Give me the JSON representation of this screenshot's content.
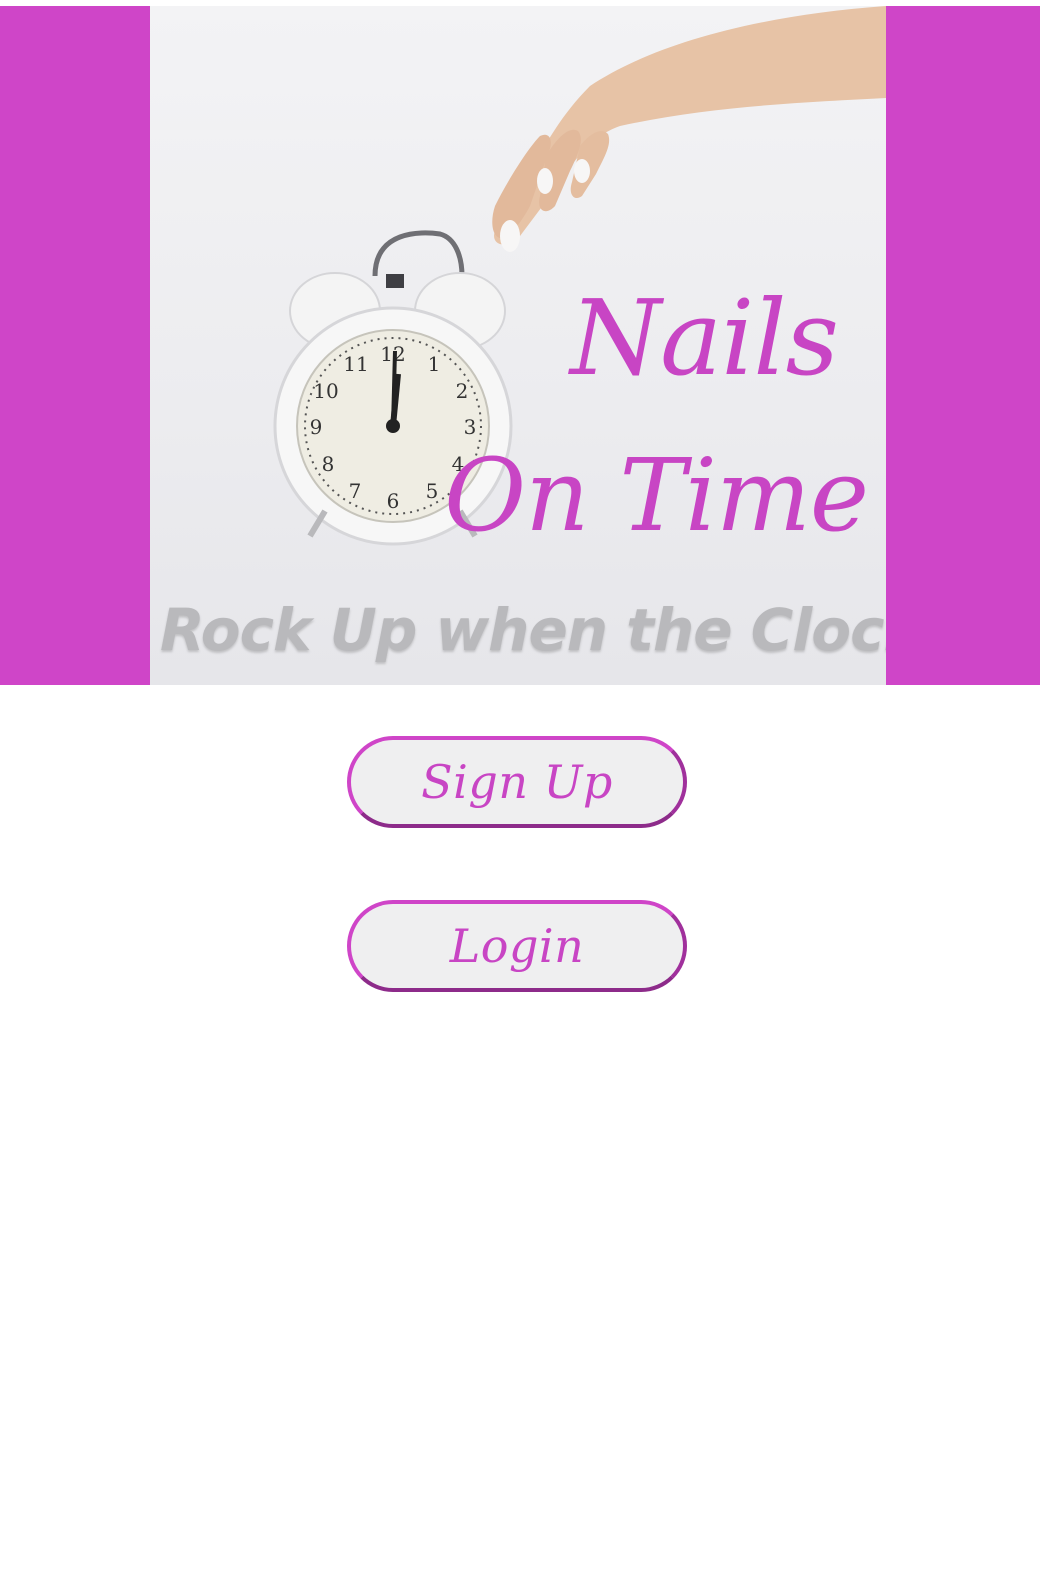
{
  "hero": {
    "title_line_1": "Nails",
    "title_line_2": "On Time",
    "tagline": "Rock Up when the Clock Up",
    "image_description_icon": "alarm-clock-icon"
  },
  "actions": {
    "signup_label": "Sign Up",
    "login_label": "Login"
  },
  "colors": {
    "brand": "#cf45c8",
    "brand_text": "#c845c4",
    "button_fill": "#efeff0",
    "button_shadow_edge": "#8d2b8a"
  }
}
